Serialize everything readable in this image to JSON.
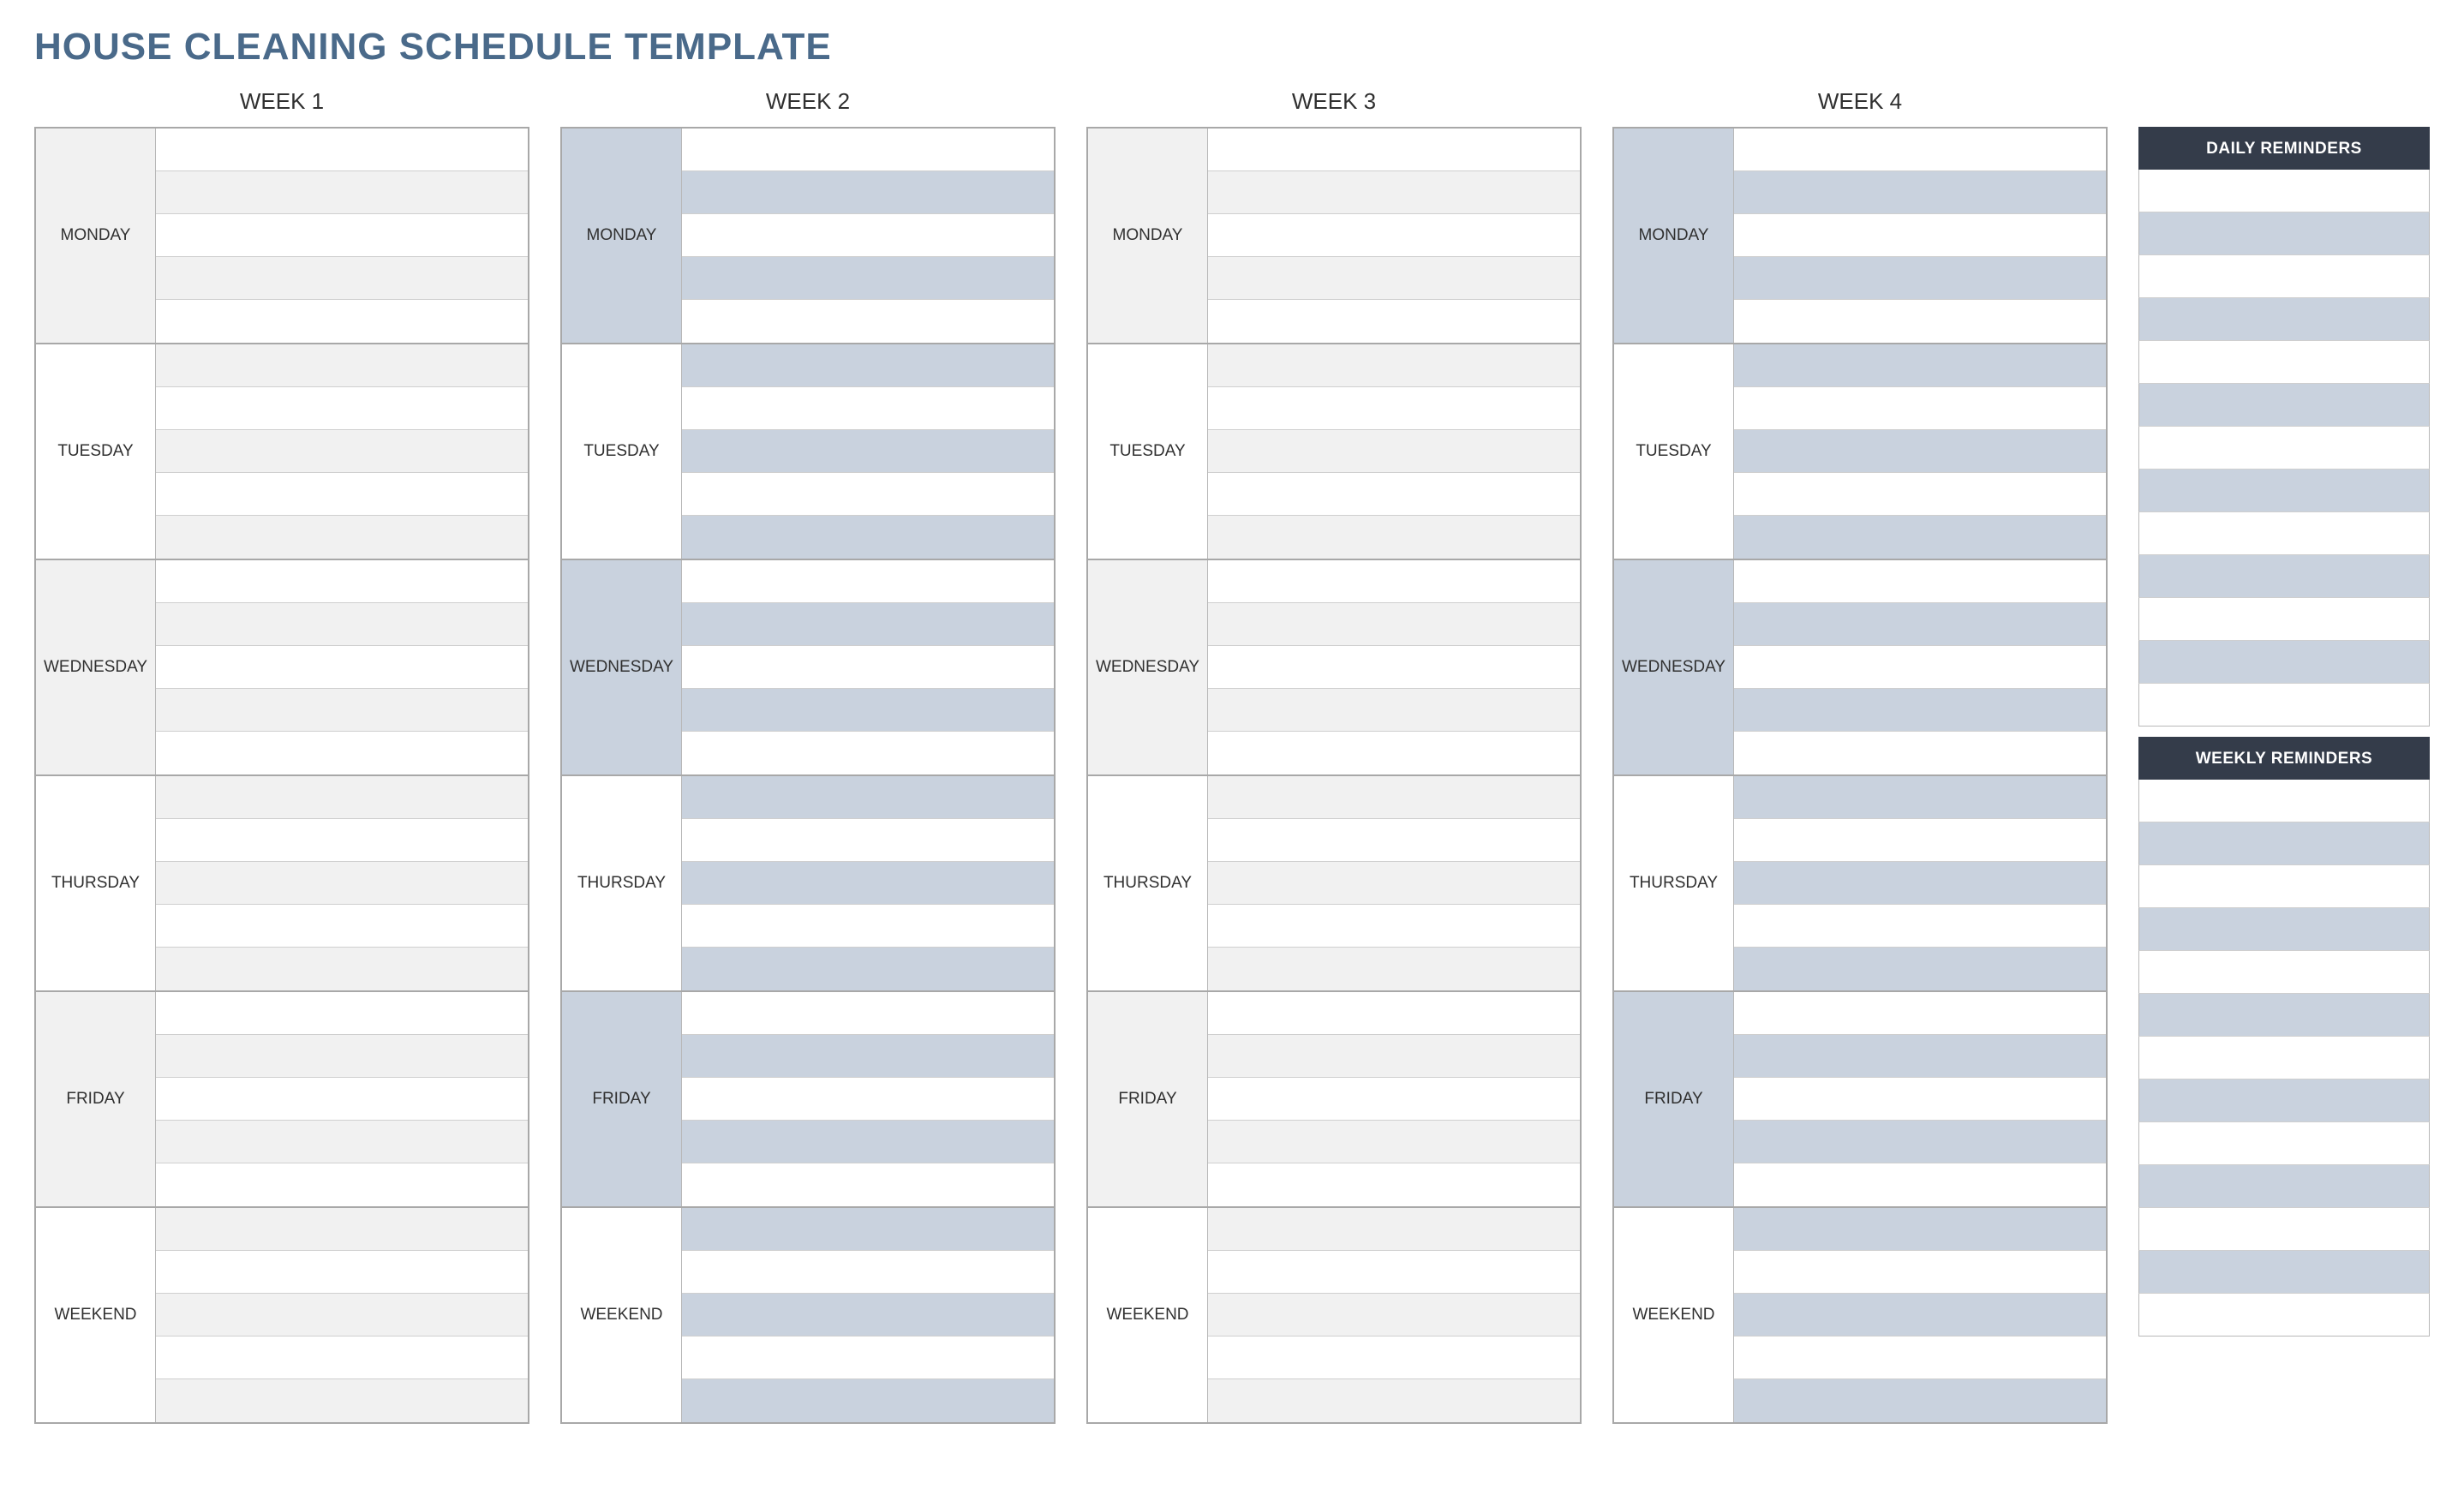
{
  "title": "HOUSE CLEANING SCHEDULE TEMPLATE",
  "days": [
    "MONDAY",
    "TUESDAY",
    "WEDNESDAY",
    "THURSDAY",
    "FRIDAY",
    "WEEKEND"
  ],
  "slots_per_day": 5,
  "weeks": [
    {
      "label": "WEEK 1",
      "odd_label_color": "grey",
      "odd_slot_color": "grey"
    },
    {
      "label": "WEEK 2",
      "odd_label_color": "blue",
      "odd_slot_color": "blue"
    },
    {
      "label": "WEEK 3",
      "odd_label_color": "grey",
      "odd_slot_color": "grey"
    },
    {
      "label": "WEEK 4",
      "odd_label_color": "blue",
      "odd_slot_color": "blue"
    }
  ],
  "reminders": {
    "daily": {
      "header": "DAILY REMINDERS",
      "rows": 13
    },
    "weekly": {
      "header": "WEEKLY REMINDERS",
      "rows": 13
    }
  }
}
